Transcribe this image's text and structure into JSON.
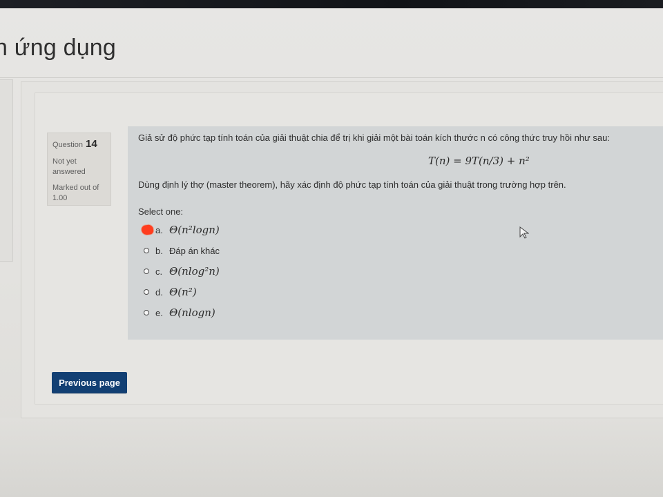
{
  "page": {
    "title_fragment": "n ứng dụng"
  },
  "question_info": {
    "label": "Question",
    "number": "14",
    "status": "Not yet answered",
    "marked_out_of": "Marked out of",
    "score": "1.00"
  },
  "question": {
    "text_1": "Giả sử độ phức tạp tính toán của giải thuật chia để trị khi giải một bài toán kích thước n có công thức truy hồi như sau:",
    "formula": "T(n) = 9T(n/3) + n²",
    "text_2": "Dùng định lý thợ (master theorem), hãy xác định độ phức tạp tính toán của giải thuật trong trường hợp trên.",
    "select_label": "Select one:",
    "answers": [
      {
        "letter": "a.",
        "text": "Θ(n²logn)"
      },
      {
        "letter": "b.",
        "text": "Đáp án khác"
      },
      {
        "letter": "c.",
        "text": "Θ(nlog²n)"
      },
      {
        "letter": "d.",
        "text": "Θ(n²)"
      },
      {
        "letter": "e.",
        "text": "Θ(nlogn)"
      }
    ]
  },
  "navigation": {
    "previous_page_label": "Previous page"
  },
  "colors": {
    "question_panel": "#d2d5d6",
    "info_panel": "#dcdad6",
    "button_bg": "#123f73",
    "mark_color": "#ff3d1f"
  },
  "icons": {
    "cursor": "mouse-pointer-icon",
    "answer_mark": "red-mark-icon"
  }
}
